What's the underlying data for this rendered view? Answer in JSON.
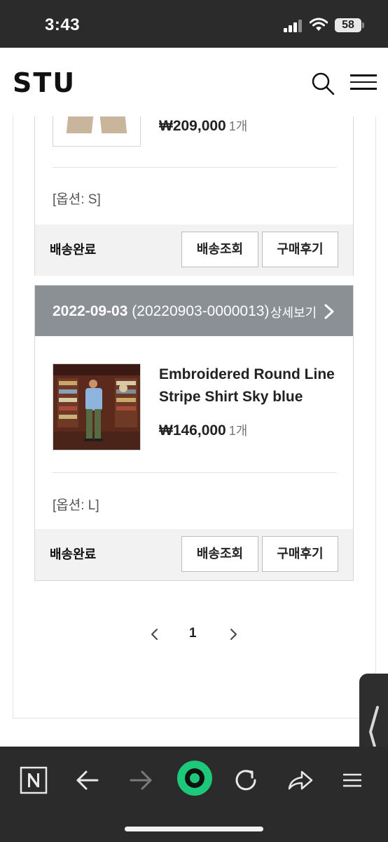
{
  "status_bar": {
    "time": "3:43",
    "battery": "58"
  },
  "header": {
    "logo": "STU"
  },
  "order1": {
    "price": "₩209,000",
    "qty": "1개",
    "option": "[옵션: S]",
    "status": "배송완료",
    "track_label": "배송조회",
    "review_label": "구매후기"
  },
  "order2": {
    "date": "2022-09-03",
    "order_no": "(20220903-0000013)",
    "detail_label": "상세보기",
    "product_name": "Embroidered Round Line Stripe Shirt Sky blue",
    "price": "₩146,000",
    "qty": "1개",
    "option": "[옵션: L]",
    "status": "배송완료",
    "track_label": "배송조회",
    "review_label": "구매후기"
  },
  "pagination": {
    "current": "1"
  },
  "colors": {
    "order_header_bg": "#8b9095",
    "footer_bg": "#f2f2f2",
    "browser_bar_bg": "#2b2b2b",
    "accent_green": "#1ec87a"
  },
  "icons": {
    "search": "search-icon",
    "menu": "hamburger-menu-icon",
    "detail": "chevron-right-icon",
    "browser_bar": [
      "naver-n-icon",
      "back-arrow-icon",
      "forward-arrow-icon",
      "green-dot-home-icon",
      "reload-icon",
      "share-icon",
      "menu-icon"
    ]
  }
}
